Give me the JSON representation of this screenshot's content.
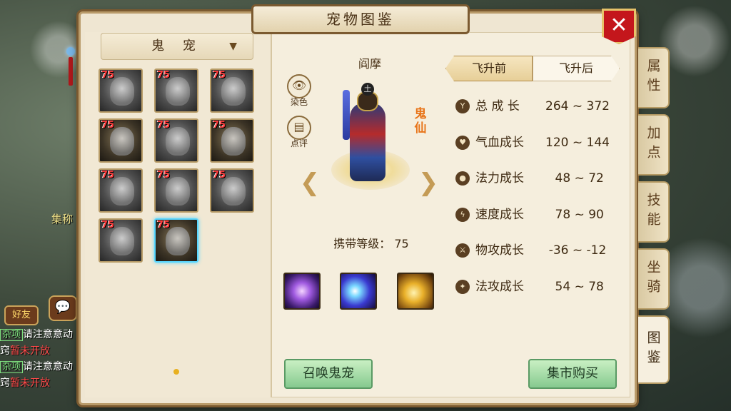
{
  "panel": {
    "title": "宠物图鉴",
    "close_label": "✕"
  },
  "category_dropdown": {
    "selected": "鬼 宠",
    "caret": "▼"
  },
  "pet_grid": [
    {
      "level": "75",
      "selected": false
    },
    {
      "level": "75",
      "selected": false
    },
    {
      "level": "75",
      "selected": false
    },
    {
      "level": "75",
      "selected": false
    },
    {
      "level": "75",
      "selected": false
    },
    {
      "level": "75",
      "selected": false
    },
    {
      "level": "75",
      "selected": false
    },
    {
      "level": "75",
      "selected": false
    },
    {
      "level": "75",
      "selected": false
    },
    {
      "level": "75",
      "selected": false
    },
    {
      "level": "75",
      "selected": true
    }
  ],
  "pet": {
    "name": "阎摩",
    "type_tag": "鬼仙",
    "hat_glyph": "土",
    "carry_level": "携带等级： 75",
    "dye_label": "染色",
    "review_label": "点评"
  },
  "ascend_toggle": {
    "before": "飞升前",
    "after": "飞升后"
  },
  "stats": [
    {
      "icon": "growth-icon",
      "label": "总 成 长",
      "value": "264 ~ 372"
    },
    {
      "icon": "hp-icon",
      "label": "气血成长",
      "value": "120 ~ 144"
    },
    {
      "icon": "mana-icon",
      "label": "法力成长",
      "value": " 48 ~ 72"
    },
    {
      "icon": "speed-icon",
      "label": "速度成长",
      "value": " 78 ~ 90"
    },
    {
      "icon": "physical-attack-icon",
      "label": "物攻成长",
      "value": "-36 ~ -12"
    },
    {
      "icon": "magic-attack-icon",
      "label": "法攻成长",
      "value": " 54 ~ 78"
    }
  ],
  "buttons": {
    "summon": "召唤鬼宠",
    "market": "集市购买"
  },
  "side_tabs": [
    "属性",
    "加点",
    "技能",
    "坐骑",
    "图鉴"
  ],
  "chat": {
    "friends_tab": "好友",
    "gather": "集称",
    "lines": [
      {
        "tag": "杂项",
        "text": "请注意意动",
        "cont": "窍",
        "red": "暂未开放"
      },
      {
        "tag": "杂项",
        "text": "请注意意动",
        "cont": "窍",
        "red": "暂未开放"
      }
    ]
  },
  "colors": {
    "accent": "#c4161c",
    "level_badge": "#ff3b3b",
    "selected_border": "#58d6ff",
    "button_green": "#86c98f"
  }
}
